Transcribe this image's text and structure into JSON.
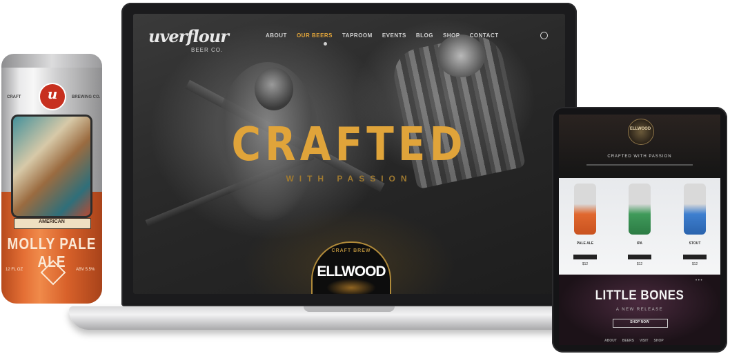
{
  "laptop": {
    "logo": "uverflour",
    "logo_sub": "BEER CO.",
    "nav": [
      "ABOUT",
      "OUR BEERS",
      "TAPROOM",
      "EVENTS",
      "BLOG",
      "SHOP",
      "CONTACT"
    ],
    "hero_title": "CRAFTED",
    "hero_subtitle": "WITH PASSION",
    "badge_top": "CRAFT BREW",
    "badge_main": "ELLWOOD",
    "accent_color": "#e0a43a"
  },
  "can": {
    "logo": "u",
    "label_left": "CRAFT",
    "label_right": "BREWING CO.",
    "banner": "AMERICAN",
    "name": "MOLLY PALE ALE",
    "foot_left": "12 FL OZ",
    "foot_right": "ABV 5.5%"
  },
  "tablet": {
    "logo": "ELLWOOD",
    "tagline": "CRAFTED WITH PASSION",
    "products": [
      {
        "label": "PALE ALE",
        "price": "$12"
      },
      {
        "label": "IPA",
        "price": "$12"
      },
      {
        "label": "STOUT",
        "price": "$12"
      }
    ],
    "promo_title": "LITTLE BONES",
    "promo_subtitle": "A NEW RELEASE",
    "promo_button": "SHOP NOW",
    "dots": "• • •",
    "footer": [
      "ABOUT",
      "BEERS",
      "VISIT",
      "SHOP"
    ]
  }
}
